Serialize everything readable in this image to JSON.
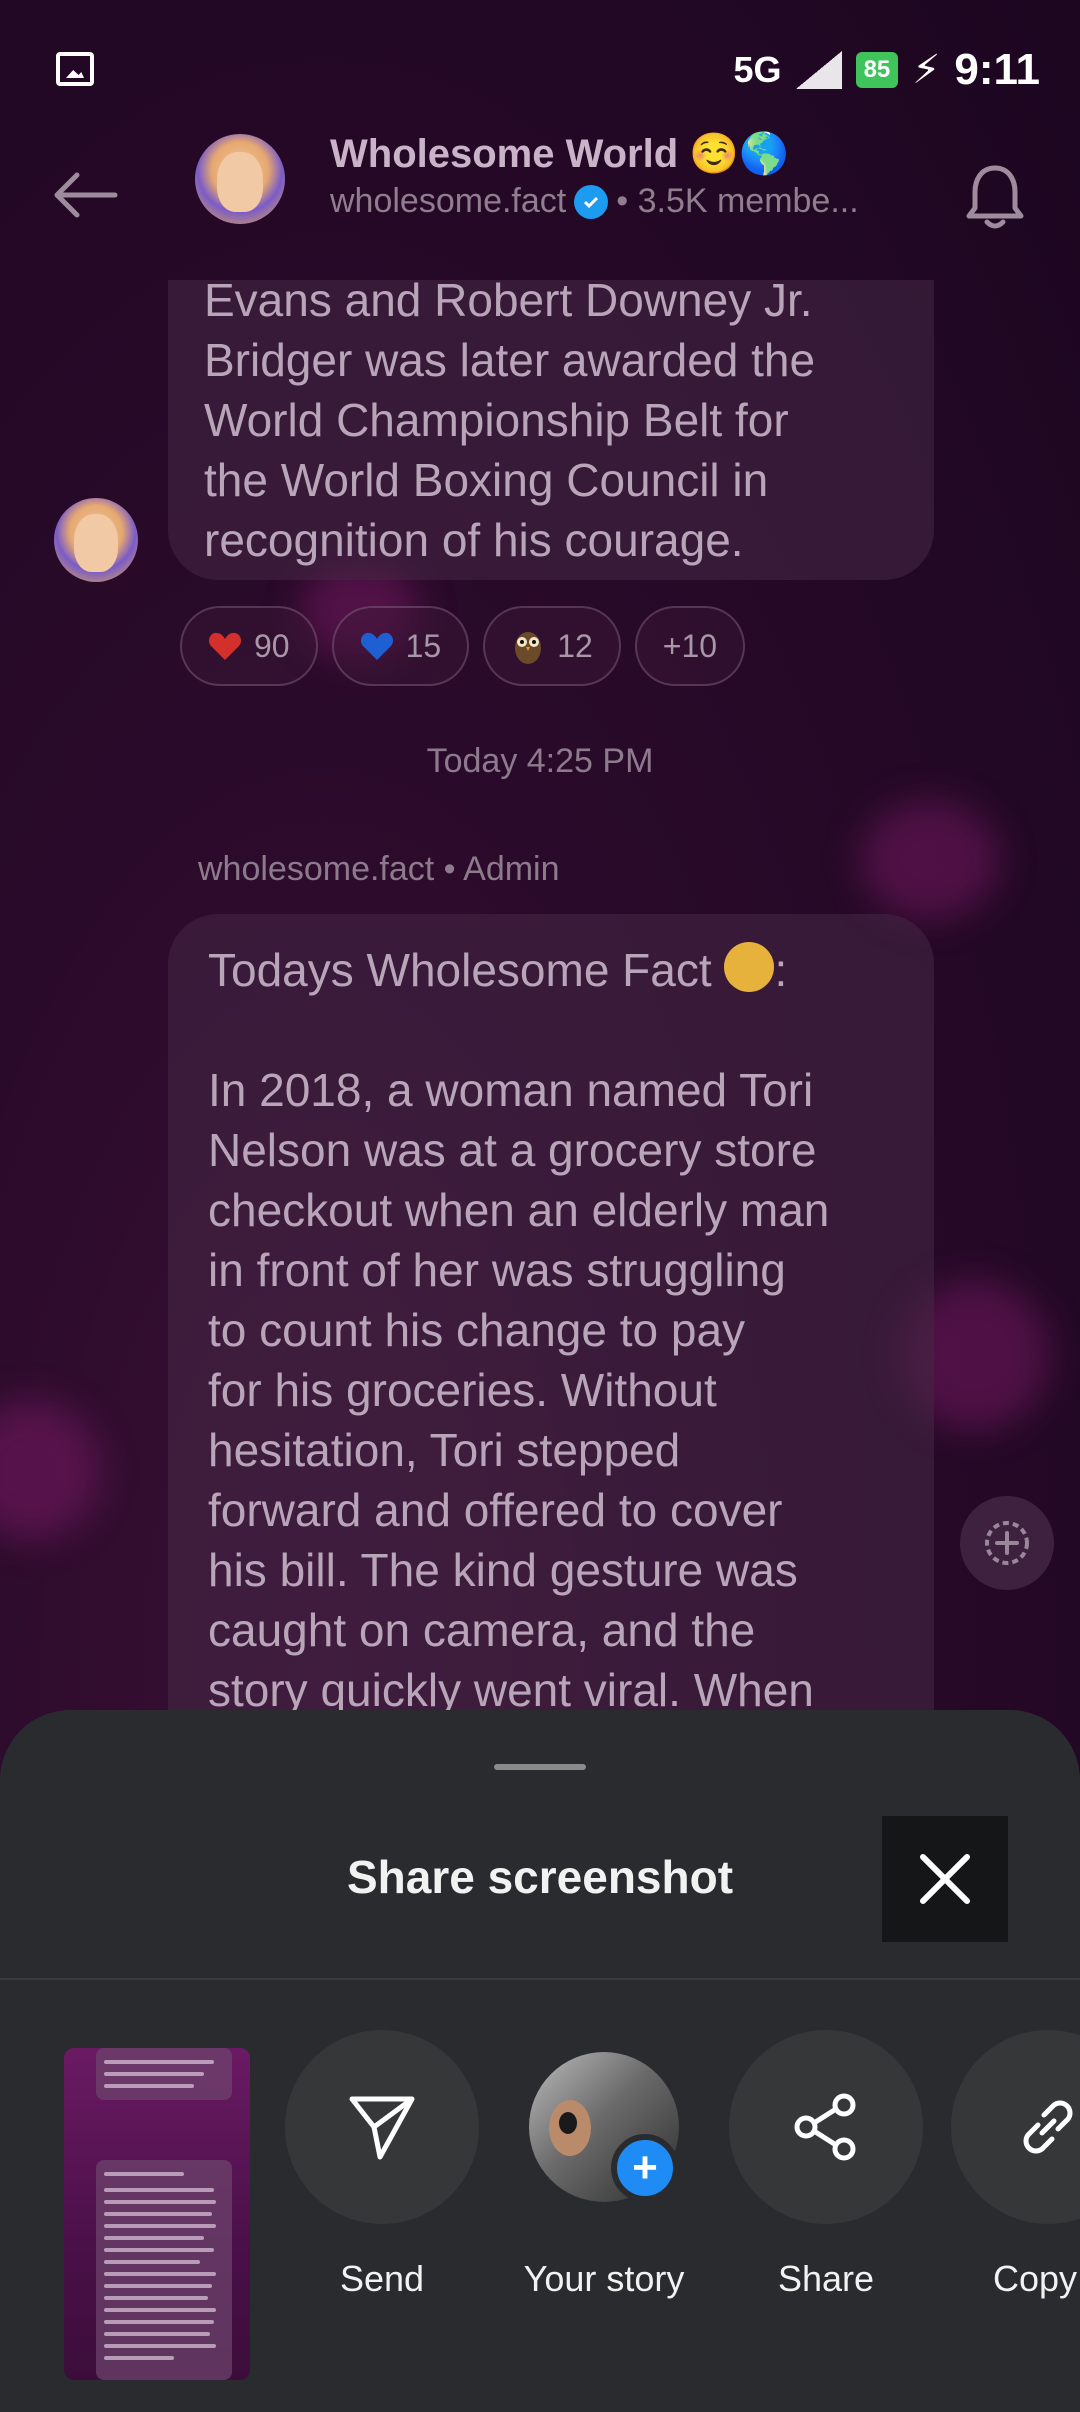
{
  "status_bar": {
    "network": "5G",
    "battery": "85",
    "time": "9:11"
  },
  "header": {
    "title": "Wholesome World ☺️🌎",
    "handle": "wholesome.fact",
    "members": "• 3.5K membe..."
  },
  "messages": [
    {
      "text": "Evans and Robert Downey Jr.\nBridger was later awarded the\nWorld Championship Belt for\nthe World Boxing Council in\nrecognition of his courage.",
      "reactions": [
        {
          "emoji": "heart-red",
          "count": "90"
        },
        {
          "emoji": "heart-blue",
          "count": "15"
        },
        {
          "emoji": "owl",
          "count": "12"
        },
        {
          "emoji": "",
          "count": "+10"
        }
      ]
    }
  ],
  "timestamp": "Today 4:25 PM",
  "sender": "wholesome.fact • Admin",
  "message2": {
    "heading": "Todays Wholesome Fact",
    "heading_suffix": ":",
    "body": "In 2018, a woman named Tori\nNelson was at a grocery store\ncheckout when an elderly man\nin front of her was struggling\nto count his change to pay\nfor his groceries. Without\nhesitation, Tori stepped\nforward and offered to cover\nhis bill. The kind gesture was\ncaught on camera, and the\nstory quickly went viral. When"
  },
  "share_sheet": {
    "title": "Share screenshot",
    "options": [
      {
        "label": "Send",
        "icon": "send-icon"
      },
      {
        "label": "Your story",
        "icon": "story-avatar"
      },
      {
        "label": "Share",
        "icon": "share-icon"
      },
      {
        "label": "Copy li",
        "icon": "link-icon"
      }
    ]
  },
  "colors": {
    "accent_blue": "#1f8cf5",
    "sheet_bg": "#2a2b2e",
    "battery_green": "#3ec45a"
  }
}
